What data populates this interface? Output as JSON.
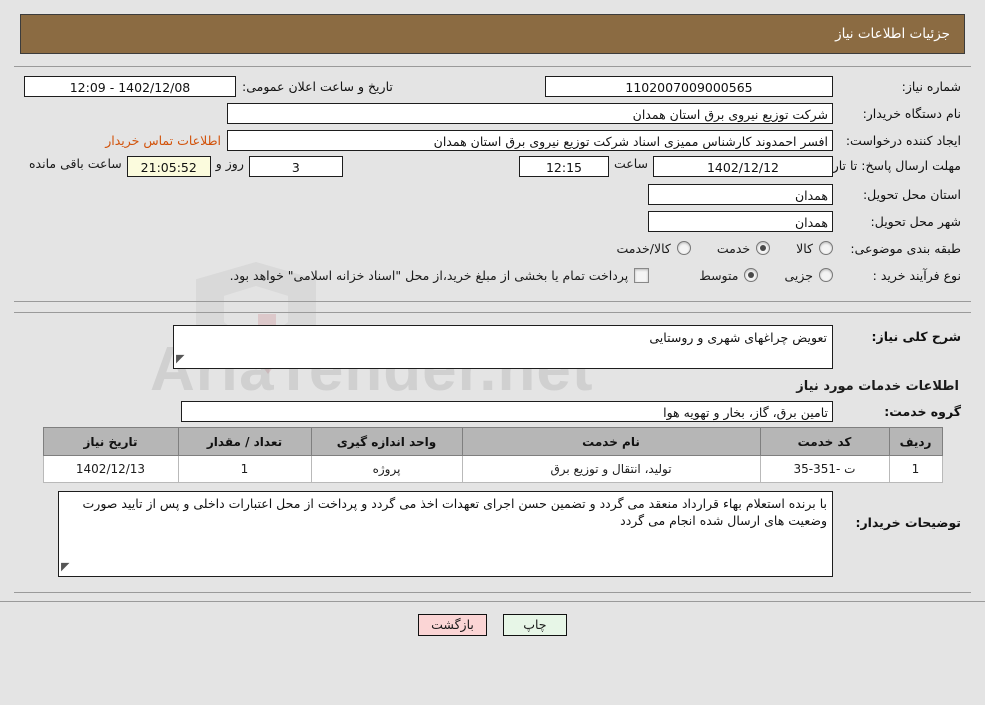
{
  "header": {
    "title": "جزئیات اطلاعات نیاز"
  },
  "watermark": {
    "text": "AriaTender.net",
    "mark": "V"
  },
  "info": {
    "need_number_label": "شماره نیاز:",
    "need_number_value": "1102007009000565",
    "announce_label": "تاریخ و ساعت اعلان عمومی:",
    "announce_value": "1402/12/08 - 12:09",
    "buyer_org_label": "نام دستگاه خریدار:",
    "buyer_org_value": "شرکت توزیع نیروی برق استان همدان",
    "requester_label": "ایجاد کننده درخواست:",
    "requester_value": "افسر احمدوند کارشناس ممیزی اسناد شرکت توزیع نیروی برق استان همدان",
    "contact_link": "اطلاعات تماس خریدار",
    "deadline_label": "مهلت ارسال پاسخ: تا تاریخ:",
    "deadline_date": "1402/12/12",
    "deadline_hour_label": "ساعت",
    "deadline_hour": "12:15",
    "remaining_days": "3",
    "remaining_days_suffix": "روز و",
    "remaining_time": "21:05:52",
    "remaining_suffix": "ساعت باقی مانده",
    "province_label": "استان محل تحویل:",
    "province_value": "همدان",
    "city_label": "شهر محل تحویل:",
    "city_value": "همدان",
    "category_label": "طبقه بندی موضوعی:",
    "category_options": [
      {
        "label": "کالا",
        "selected": false
      },
      {
        "label": "خدمت",
        "selected": true
      },
      {
        "label": "کالا/خدمت",
        "selected": false
      }
    ],
    "process_label": "نوع فرآیند خرید :",
    "process_options": [
      {
        "label": "جزیی",
        "selected": true
      },
      {
        "label": "متوسط",
        "selected": false
      }
    ],
    "treasury_checkbox_label": "پرداخت تمام یا بخشی از مبلغ خرید،از محل \"اسناد خزانه اسلامی\" خواهد بود.",
    "treasury_checked": false
  },
  "need": {
    "summary_label": "شرح کلی نیاز:",
    "summary_value": "تعویض چراغهای شهری و روستایی",
    "services_section_title": "اطلاعات خدمات مورد نیاز",
    "service_group_label": "گروه خدمت:",
    "service_group_value": "تامین برق، گاز، بخار و تهویه هوا"
  },
  "table": {
    "columns": [
      "ردیف",
      "کد خدمت",
      "نام خدمت",
      "واحد اندازه گیری",
      "تعداد / مقدار",
      "تاریخ نیاز"
    ],
    "rows": [
      {
        "index": "1",
        "code": "ت -351-35",
        "name": "تولید، انتقال و توزیع برق",
        "unit": "پروژه",
        "quantity": "1",
        "date": "1402/12/13"
      }
    ]
  },
  "notes": {
    "label": "توضیحات خریدار:",
    "value": "با برنده استعلام بهاء قرارداد منعقد می گردد و تضمین حسن اجرای تعهدات اخذ می گردد و پرداخت از محل اعتبارات داخلی و پس از تایید صورت وضعیت های ارسال شده انجام می گردد"
  },
  "buttons": {
    "print": "چاپ",
    "back": "بازگشت"
  }
}
